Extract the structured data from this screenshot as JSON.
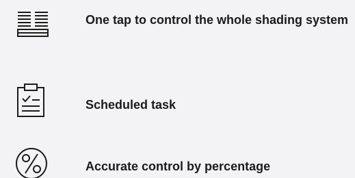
{
  "features": [
    {
      "icon": "shading-blinds-icon",
      "label": "One tap to control the whole shading system"
    },
    {
      "icon": "clipboard-checklist-icon",
      "label": "Scheduled task"
    },
    {
      "icon": "percent-circle-icon",
      "label": "Accurate control by percentage"
    }
  ]
}
